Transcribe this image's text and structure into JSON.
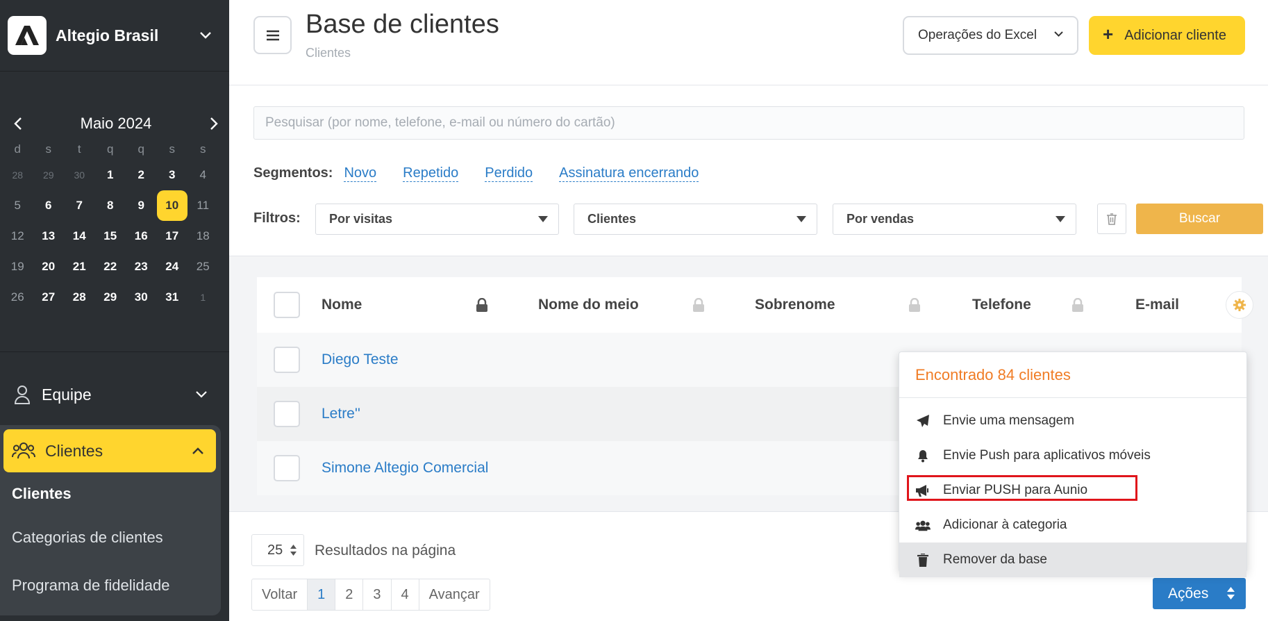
{
  "sidebar": {
    "brand": "Altegio Brasil",
    "calendar": {
      "title": "Maio 2024",
      "weekdays": [
        "d",
        "s",
        "t",
        "q",
        "q",
        "s",
        "s"
      ],
      "weeks": [
        [
          "28",
          "29",
          "30",
          "1",
          "2",
          "3",
          "4"
        ],
        [
          "5",
          "6",
          "7",
          "8",
          "9",
          "10",
          "11"
        ],
        [
          "12",
          "13",
          "14",
          "15",
          "16",
          "17",
          "18"
        ],
        [
          "19",
          "20",
          "21",
          "22",
          "23",
          "24",
          "25"
        ],
        [
          "26",
          "27",
          "28",
          "29",
          "30",
          "31",
          "1"
        ]
      ],
      "today": "10"
    },
    "nav": {
      "equipe": "Equipe",
      "clientes": "Clientes",
      "sub": [
        "Clientes",
        "Categorias de clientes",
        "Programa de fidelidade"
      ]
    }
  },
  "header": {
    "title": "Base de clientes",
    "breadcrumb": "Clientes",
    "excel_label": "Operações do Excel",
    "add_label": "Adicionar cliente"
  },
  "search": {
    "placeholder": "Pesquisar (por nome, telefone, e-mail ou número do cartão)"
  },
  "segments": {
    "label": "Segmentos:",
    "items": [
      "Novo",
      "Repetido",
      "Perdido",
      "Assinatura encerrando"
    ]
  },
  "filters": {
    "label": "Filtros:",
    "selects": [
      "Por visitas",
      "Clientes",
      "Por vendas"
    ],
    "search_label": "Buscar"
  },
  "table": {
    "columns": [
      "Nome",
      "Nome do meio",
      "Sobrenome",
      "Telefone",
      "E-mail"
    ],
    "rows": [
      "Diego Teste",
      "Letre''",
      "Simone Altegio Comercial"
    ]
  },
  "pagination": {
    "per_page": "25",
    "per_page_label": "Resultados na página",
    "prev": "Voltar",
    "pages": [
      "1",
      "2",
      "3",
      "4"
    ],
    "next": "Avançar",
    "current": "1"
  },
  "actions": {
    "label": "Ações",
    "menu_title": "Encontrado 84 clientes",
    "items": [
      "Envie uma mensagem",
      "Envie Push para aplicativos móveis",
      "Enviar PUSH para Aunio",
      "Adicionar à categoria",
      "Remover da base"
    ]
  },
  "colors": {
    "accent_yellow": "#ffd52e",
    "link_blue": "#2a7cc7",
    "sidebar_bg": "#2b2f33",
    "highlight_red": "#e0151b",
    "menu_title_orange": "#f07c25"
  }
}
